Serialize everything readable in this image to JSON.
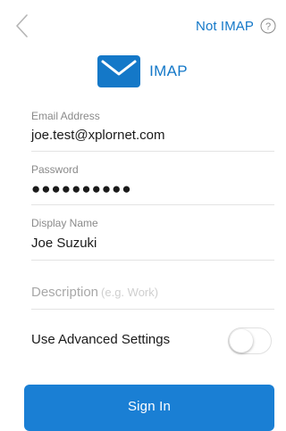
{
  "header": {
    "back_icon": "chevron-left-icon",
    "not_imap_label": "Not IMAP",
    "help_icon": "question-circle-icon"
  },
  "brand": {
    "icon": "mail-envelope-icon",
    "title": "IMAP",
    "accent_color": "#1478c8"
  },
  "form": {
    "email": {
      "label": "Email Address",
      "value": "joe.test@xplornet.com"
    },
    "password": {
      "label": "Password",
      "value": "●●●●●●●●●●"
    },
    "display_name": {
      "label": "Display Name",
      "value": "Joe Suzuki"
    },
    "description": {
      "label": "Description",
      "placeholder": "(e.g. Work)"
    },
    "advanced": {
      "label": "Use Advanced Settings",
      "enabled": false
    }
  },
  "signin": {
    "label": "Sign In",
    "color": "#1a7fd4"
  }
}
